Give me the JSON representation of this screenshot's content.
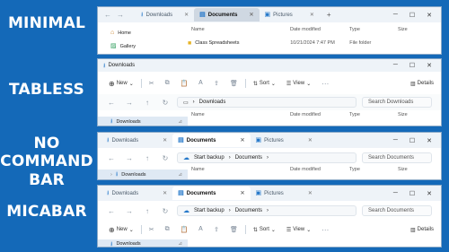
{
  "labels": {
    "minimal": "MINIMAL",
    "tabless": "TABLESS",
    "no_command_bar": "NO COMMAND BAR",
    "micabar": "MICABAR"
  },
  "w1": {
    "tabs": [
      "Downloads",
      "Documents",
      "Pictures"
    ],
    "sidebar": [
      "Home",
      "Gallery"
    ],
    "columns": [
      "Name",
      "Date modified",
      "Type",
      "Size"
    ],
    "file": {
      "name": "Class Spreadsheets",
      "date": "10/21/2024 7:47 PM",
      "type": "File folder"
    }
  },
  "w2": {
    "title": "Downloads",
    "new_label": "New",
    "sort_label": "Sort",
    "view_label": "View",
    "details_label": "Details",
    "address": "Downloads",
    "search_placeholder": "Search Downloads",
    "sidebar_selected": "Downloads",
    "columns": [
      "Name",
      "Date modified",
      "Type",
      "Size"
    ]
  },
  "w3": {
    "tabs": [
      "Downloads",
      "Documents",
      "Pictures"
    ],
    "backup": "Start backup",
    "address": "Documents",
    "search_placeholder": "Search Documents",
    "sidebar_selected": "Downloads",
    "columns": [
      "Name",
      "Date modified",
      "Type",
      "Size"
    ]
  },
  "w4": {
    "tabs": [
      "Downloads",
      "Documents",
      "Pictures"
    ],
    "backup": "Start backup",
    "address": "Documents",
    "search_placeholder": "Search Documents",
    "new_label": "New",
    "sort_label": "Sort",
    "view_label": "View",
    "details_label": "Details",
    "sidebar_selected": "Downloads"
  },
  "icons": {
    "min": "minimize-icon",
    "max": "maximize-icon",
    "close": "close-icon"
  },
  "colors": {
    "background": "#1469b8",
    "accent": "#2377c9",
    "selected": "#dfe9f4"
  }
}
